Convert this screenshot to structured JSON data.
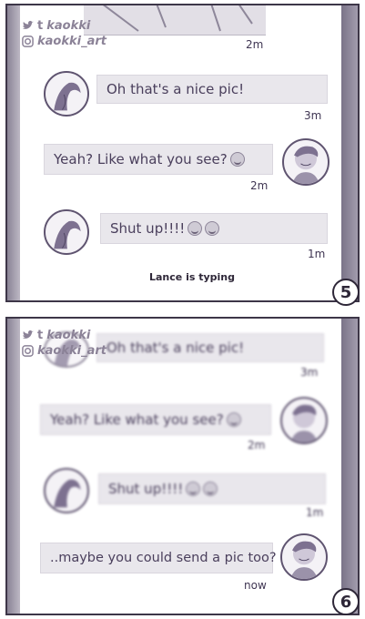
{
  "credits": {
    "twitter": "kaokki",
    "instagram": "kaokki_art"
  },
  "panel5": {
    "top_time": "2m",
    "messages": [
      {
        "text": "Oh that's a nice pic!",
        "time": "3m"
      },
      {
        "text": "Yeah? Like what you see?",
        "time": "2m"
      },
      {
        "text": "Shut up!!!!",
        "time": "1m"
      }
    ],
    "typing": "Lance is typing",
    "number": "5"
  },
  "panel6": {
    "messages": [
      {
        "text": "Oh that's a nice pic!",
        "time": "3m"
      },
      {
        "text": "Yeah? Like what you see?",
        "time": "2m"
      },
      {
        "text": "Shut up!!!!",
        "time": "1m"
      },
      {
        "text": "..maybe you could send a pic too?",
        "time": "now"
      }
    ],
    "number": "6"
  },
  "icons": [
    "twitter-icon",
    "tumblr-icon",
    "instagram-icon",
    "smirk-emoji-icon",
    "laughing-emoji-icon"
  ],
  "colors": {
    "ink": "#3f3552",
    "bubble": "#e9e7ec",
    "frame": "#3d3648"
  }
}
